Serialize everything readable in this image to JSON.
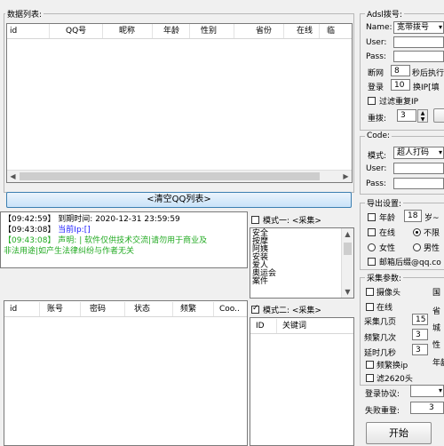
{
  "data_list": {
    "title": "数据列表:",
    "columns": [
      "id",
      "QQ号",
      "昵称",
      "年龄",
      "性别",
      "省份",
      "在线",
      "临"
    ]
  },
  "clear_button": "<清空QQ列表>",
  "log": {
    "lines": [
      {
        "time": "【09:42:59】",
        "text": "到期时间: 2020-12-31 23:59:59",
        "color": "#000000"
      },
      {
        "time": "【09:43:08】",
        "text": "当前Ip:[]",
        "color": "#1a1aff"
      },
      {
        "time": "【09:43:08】",
        "text": "声明: | 软件仅供技术交流|请勿用于商业及",
        "color": "#22aa22"
      },
      {
        "time": "",
        "text": "非法用途|如产生法律纠纷与作者无关",
        "color": "#22aa22"
      }
    ]
  },
  "account_list": {
    "columns": [
      "id",
      "账号",
      "密码",
      "状态",
      "频繁",
      "Coo.."
    ]
  },
  "mode1": {
    "label": "模式一: <采集>",
    "items": [
      "安全",
      "按摩",
      "阿姨",
      "安装",
      "爱人",
      "奥运会",
      "案件"
    ]
  },
  "mode2": {
    "label": "模式二: <采集>",
    "columns": [
      "ID",
      "关键词"
    ]
  },
  "adsl": {
    "title": "Adsl拨号:",
    "name_label": "Name:",
    "name_value": "宽带拨号",
    "user_label": "User:",
    "pass_label": "Pass:",
    "disconnect_label": "断网",
    "disconnect_value": "8",
    "disconnect_suffix": "秒后执行",
    "login_label": "登录",
    "login_value": "10",
    "login_suffix": "换IP[填",
    "filter_label": "过滤重复IP",
    "redial_label": "重拨:",
    "redial_value": "3"
  },
  "code": {
    "title": "Code:",
    "mode_label": "模式:",
    "mode_value": "超人打码",
    "user_label": "User:",
    "pass_label": "Pass:"
  },
  "export": {
    "title": "导出设置:",
    "age_label": "年龄",
    "age_value": "18",
    "age_suffix": "岁~",
    "online_label": "在线",
    "unlimited_label": "不限",
    "female_label": "女性",
    "male_label": "男性",
    "email_label": "邮箱后缀@qq.co"
  },
  "collect": {
    "title": "采集参数:",
    "camera_label": "摄像头",
    "country_label": "国",
    "online_label": "在线",
    "pages_label": "采集几页",
    "pages_value": "15",
    "province_label": "省",
    "freq_label": "频繁几次",
    "freq_value": "3",
    "city_label": "城",
    "delay_label": "延时几秒",
    "delay_value": "3",
    "gender_label": "性",
    "freq_ip_label": "频繁换ip",
    "age_label": "年龄",
    "filter2620_label": "滤2620头",
    "protocol_label": "登录协议:",
    "retry_label": "失败重登:",
    "retry_value": "3"
  },
  "start_button": "开始"
}
